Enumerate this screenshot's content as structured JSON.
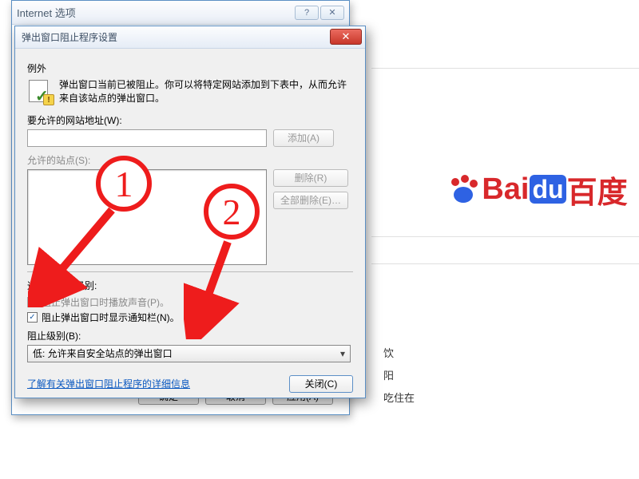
{
  "parent_window": {
    "title": "Internet 选项",
    "buttons": {
      "ok": "确定",
      "cancel": "取消",
      "apply": "应用(A)"
    }
  },
  "popup_dialog": {
    "title": "弹出窗口阻止程序设置",
    "exceptions_label": "例外",
    "description": "弹出窗口当前已被阻止。你可以将特定网站添加到下表中，从而允许来自该站点的弹出窗口。",
    "address_label": "要允许的网站地址(W):",
    "add_button": "添加(A)",
    "allowed_label": "允许的站点(S):",
    "remove_button": "删除(R)",
    "remove_all_button": "全部删除(E)…",
    "notify_section": "通知和阻止级别:",
    "check_sound": "阻止弹出窗口时播放声音(P)。",
    "check_infobar": "阻止弹出窗口时显示通知栏(N)。",
    "level_label": "阻止级别(B):",
    "level_value": "低: 允许来自安全站点的弹出窗口",
    "more_info": "了解有关弹出窗口阻止程序的详细信息",
    "close": "关闭(C)"
  },
  "background": {
    "baidu_bai": "Bai",
    "baidu_du": "du",
    "baidu_cn": "百度",
    "side1": "饮",
    "side2": "阳",
    "side3": "吃住在"
  },
  "annotations": {
    "circle1": "1",
    "circle2": "2"
  }
}
